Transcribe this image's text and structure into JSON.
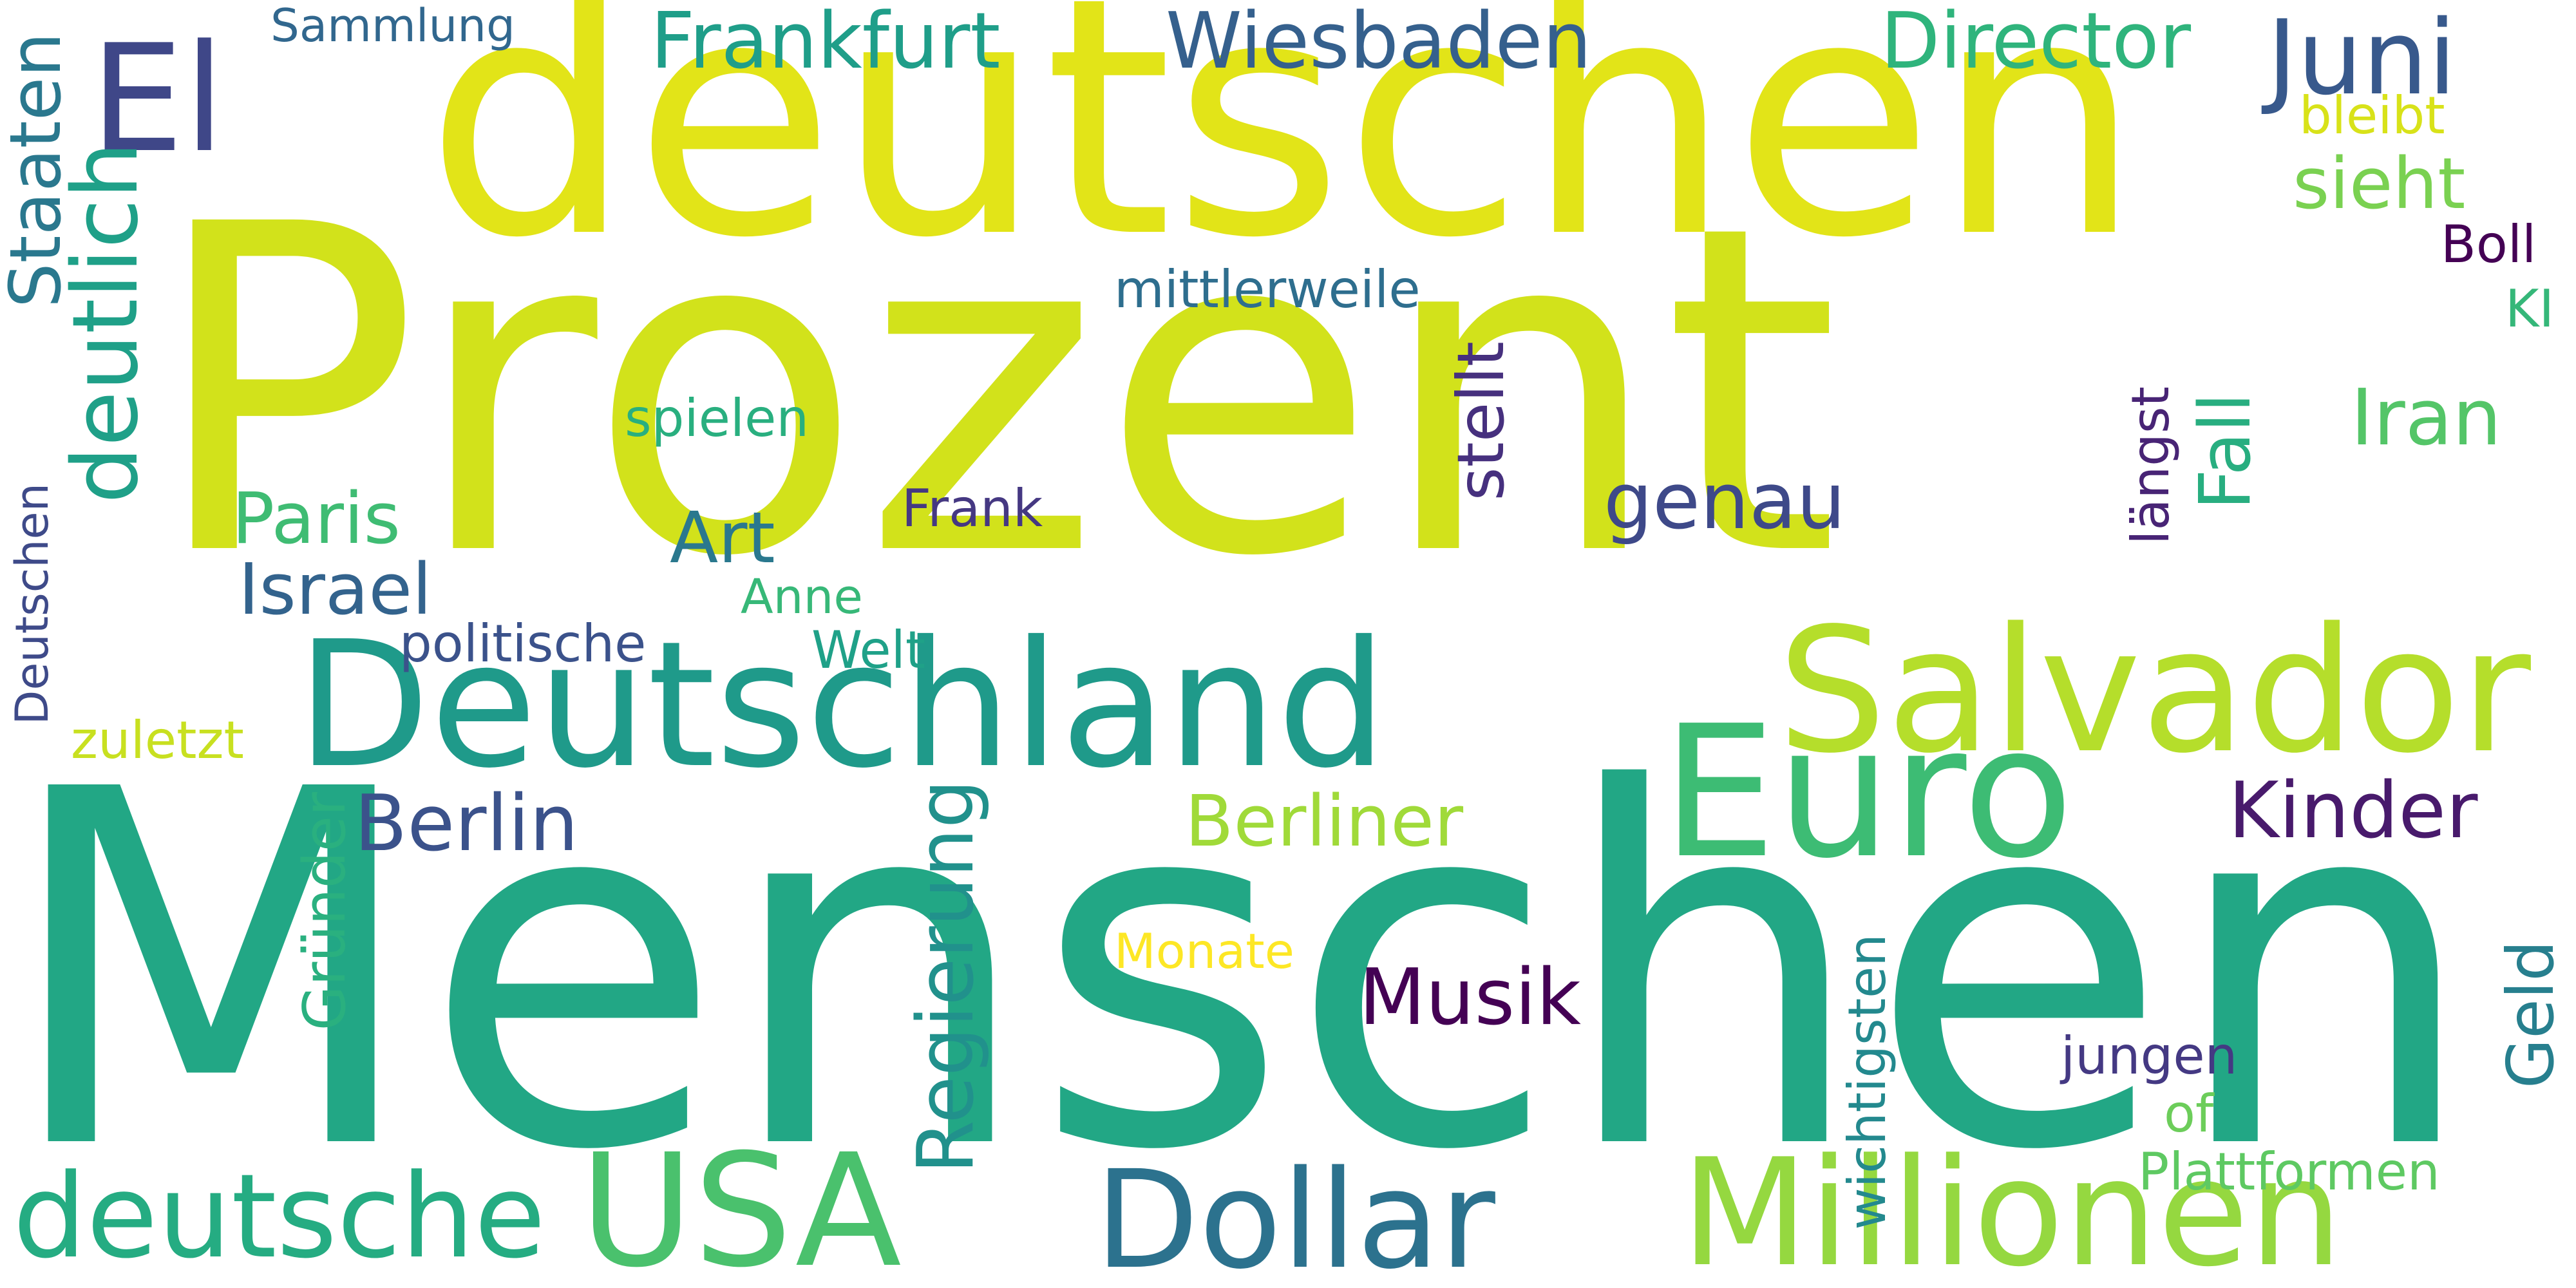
{
  "words": [
    {
      "text": "Prozent",
      "color": "#d2e21b",
      "orientation": "horizontal"
    },
    {
      "text": "Menschen",
      "color": "#22a785",
      "orientation": "horizontal"
    },
    {
      "text": "deutschen",
      "color": "#e2e418",
      "orientation": "horizontal"
    },
    {
      "text": "Deutschland",
      "color": "#1f9a8a",
      "orientation": "horizontal"
    },
    {
      "text": "Millionen",
      "color": "#95d840",
      "orientation": "horizontal"
    },
    {
      "text": "Salvador",
      "color": "#b5de2b",
      "orientation": "horizontal"
    },
    {
      "text": "USA",
      "color": "#4ac16d",
      "orientation": "horizontal"
    },
    {
      "text": "Dollar",
      "color": "#2c728e",
      "orientation": "horizontal"
    },
    {
      "text": "Euro",
      "color": "#3dbc74",
      "orientation": "horizontal"
    },
    {
      "text": "El",
      "color": "#3f4788",
      "orientation": "horizontal"
    },
    {
      "text": "deutsche",
      "color": "#25ac82",
      "orientation": "horizontal"
    },
    {
      "text": "deutlich",
      "color": "#1fa088",
      "orientation": "vertical"
    },
    {
      "text": "Regierung",
      "color": "#21918c",
      "orientation": "vertical"
    },
    {
      "text": "Juni",
      "color": "#38598c",
      "orientation": "horizontal"
    },
    {
      "text": "Wiesbaden",
      "color": "#35608d",
      "orientation": "horizontal"
    },
    {
      "text": "Frankfurt",
      "color": "#1f9e89",
      "orientation": "horizontal"
    },
    {
      "text": "Director",
      "color": "#2fb47c",
      "orientation": "horizontal"
    },
    {
      "text": "Berlin",
      "color": "#3b528b",
      "orientation": "horizontal"
    },
    {
      "text": "Berliner",
      "color": "#a0da39",
      "orientation": "horizontal"
    },
    {
      "text": "Kinder",
      "color": "#481a6c",
      "orientation": "horizontal"
    },
    {
      "text": "Musik",
      "color": "#440154",
      "orientation": "horizontal"
    },
    {
      "text": "Israel",
      "color": "#33638d",
      "orientation": "horizontal"
    },
    {
      "text": "Paris",
      "color": "#3fbc73",
      "orientation": "horizontal"
    },
    {
      "text": "Staaten",
      "color": "#2a788e",
      "orientation": "vertical"
    },
    {
      "text": "Iran",
      "color": "#54c568",
      "orientation": "horizontal"
    },
    {
      "text": "stellt",
      "color": "#46307e",
      "orientation": "vertical"
    },
    {
      "text": "genau",
      "color": "#3e4989",
      "orientation": "horizontal"
    },
    {
      "text": "sieht",
      "color": "#7ad151",
      "orientation": "horizontal"
    },
    {
      "text": "Art",
      "color": "#2a788e",
      "orientation": "horizontal"
    },
    {
      "text": "Fall",
      "color": "#28ae80",
      "orientation": "vertical"
    },
    {
      "text": "Geld",
      "color": "#277f8e",
      "orientation": "vertical"
    },
    {
      "text": "Plattformen",
      "color": "#5ec962",
      "orientation": "horizontal"
    },
    {
      "text": "Gründer",
      "color": "#2ab07f",
      "orientation": "vertical"
    },
    {
      "text": "wichtigsten",
      "color": "#23898e",
      "orientation": "vertical"
    },
    {
      "text": "Monate",
      "color": "#fde725",
      "orientation": "horizontal"
    },
    {
      "text": "jungen",
      "color": "#443983",
      "orientation": "horizontal"
    },
    {
      "text": "of",
      "color": "#6ccd5a",
      "orientation": "horizontal"
    },
    {
      "text": "Sammlung",
      "color": "#31678e",
      "orientation": "horizontal"
    },
    {
      "text": "mittlerweile",
      "color": "#2e6e8e",
      "orientation": "horizontal"
    },
    {
      "text": "spielen",
      "color": "#29af7f",
      "orientation": "horizontal"
    },
    {
      "text": "Frank",
      "color": "#453882",
      "orientation": "horizontal"
    },
    {
      "text": "Anne",
      "color": "#37b878",
      "orientation": "horizontal"
    },
    {
      "text": "politische",
      "color": "#3b528b",
      "orientation": "horizontal"
    },
    {
      "text": "Welt",
      "color": "#1fa188",
      "orientation": "horizontal"
    },
    {
      "text": "Deutschen",
      "color": "#3e4a89",
      "orientation": "vertical"
    },
    {
      "text": "zuletzt",
      "color": "#c8e020",
      "orientation": "horizontal"
    },
    {
      "text": "längst",
      "color": "#482475",
      "orientation": "vertical"
    },
    {
      "text": "bleibt",
      "color": "#d8e219",
      "orientation": "horizontal"
    },
    {
      "text": "Boll",
      "color": "#440154",
      "orientation": "horizontal"
    },
    {
      "text": "KI",
      "color": "#35b779",
      "orientation": "horizontal"
    }
  ]
}
